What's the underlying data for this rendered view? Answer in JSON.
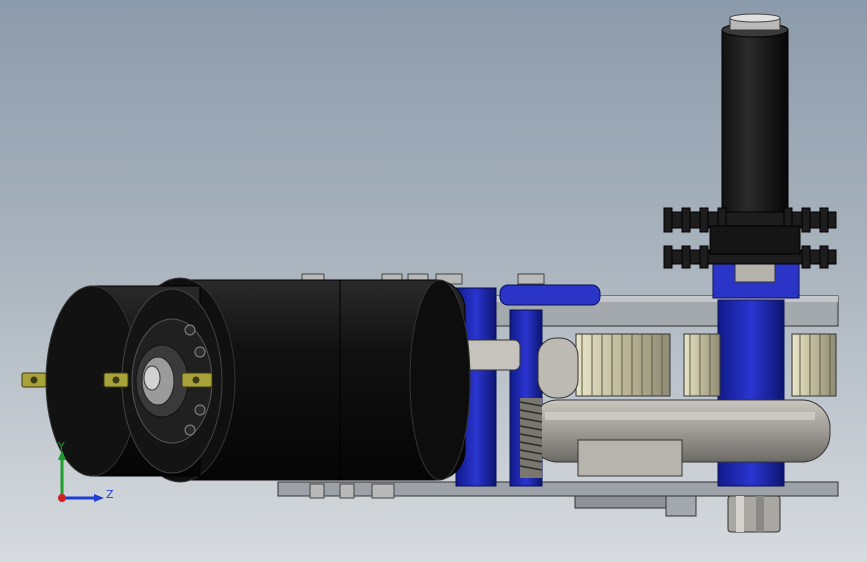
{
  "viewport": {
    "background_top": "#8c9bab",
    "background_bottom": "#d7dbdf"
  },
  "triad": {
    "y_label": "Y",
    "z_label": "Z",
    "y_color": "#1f9c2e",
    "z_color": "#1e3fd1",
    "x_color": "#d11e1e"
  },
  "model": {
    "parts": [
      "dc-motor",
      "motor-end-cap",
      "sprocket-shaft",
      "upper-sprocket",
      "lower-sprocket",
      "spur-gear-train",
      "blue-frame-plates",
      "compression-spring",
      "belt-pulley",
      "hex-nut"
    ]
  }
}
